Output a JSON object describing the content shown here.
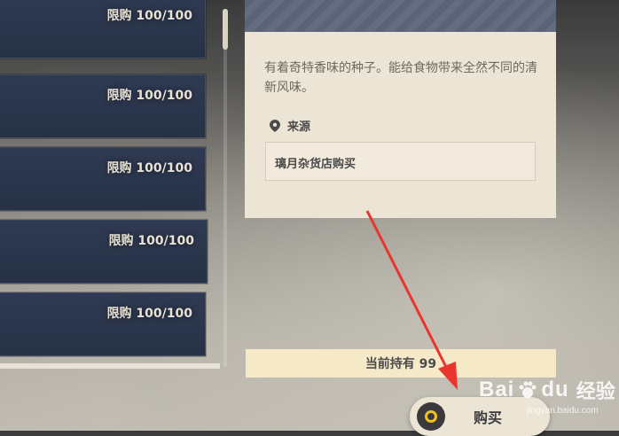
{
  "shop_list": {
    "items": [
      {
        "limit": "限购 100/100"
      },
      {
        "limit": "限购 100/100"
      },
      {
        "limit": "限购 100/100"
      },
      {
        "limit": "限购 100/100"
      },
      {
        "limit": "限购 100/100"
      }
    ]
  },
  "detail": {
    "description": "有着奇特香味的种子。能给食物带来全然不同的清新风味。",
    "source_title": "来源",
    "source_value": "璃月杂货店购买",
    "owned": "当前持有 99"
  },
  "buy_button": {
    "label": "购买",
    "icon": "controller-button-icon",
    "accent": "#f2c21c"
  },
  "annotation": {
    "arrow_color": "#e8352e"
  },
  "watermark": {
    "brand": "Bai",
    "paw": "du",
    "sub": "经验",
    "url": "jingyan.baidu.com"
  }
}
